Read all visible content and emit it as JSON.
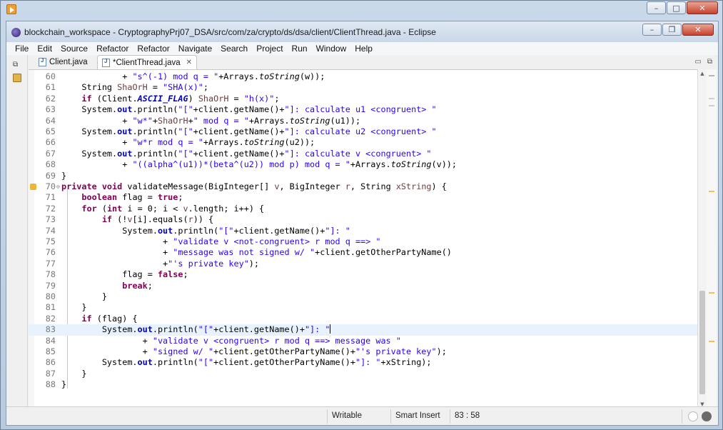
{
  "app": {
    "window_title": "blockchain_workspace - CryptographyPrj07_DSA/src/com/za/crypto/ds/dsa/client/ClientThread.java - Eclipse"
  },
  "menu": [
    "File",
    "Edit",
    "Source",
    "Refactor",
    "Refactor",
    "Navigate",
    "Search",
    "Project",
    "Run",
    "Window",
    "Help"
  ],
  "tabs": [
    {
      "label": "Client.java",
      "active": false
    },
    {
      "label": "*ClientThread.java",
      "active": true
    }
  ],
  "editor": {
    "current_line": 83,
    "lines": [
      {
        "n": "60",
        "parts": [
          [
            "t",
            "            + "
          ],
          [
            "s",
            "\"s^(-1) mod q = \""
          ],
          [
            "t",
            "+Arrays."
          ],
          [
            "i",
            "toString"
          ],
          [
            "t",
            "(w));"
          ]
        ]
      },
      {
        "n": "61",
        "parts": [
          [
            "t",
            "    String "
          ],
          [
            "v",
            "ShaOrH"
          ],
          [
            "t",
            " = "
          ],
          [
            "s",
            "\"SHA(x)\""
          ],
          [
            "t",
            ";"
          ]
        ]
      },
      {
        "n": "62",
        "parts": [
          [
            "t",
            "    "
          ],
          [
            "k",
            "if"
          ],
          [
            "t",
            " (Client."
          ],
          [
            "fi",
            "ASCII_FLAG"
          ],
          [
            "t",
            ") "
          ],
          [
            "v",
            "ShaOrH"
          ],
          [
            "t",
            " = "
          ],
          [
            "s",
            "\"h(x)\""
          ],
          [
            "t",
            ";"
          ]
        ]
      },
      {
        "n": "63",
        "parts": [
          [
            "t",
            "    System."
          ],
          [
            "f",
            "out"
          ],
          [
            "t",
            ".println("
          ],
          [
            "s",
            "\"[\""
          ],
          [
            "t",
            "+client.getName()+"
          ],
          [
            "s",
            "\"]: calculate u1 <congruent> \""
          ]
        ]
      },
      {
        "n": "64",
        "parts": [
          [
            "t",
            "            + "
          ],
          [
            "s",
            "\"w*\""
          ],
          [
            "t",
            "+"
          ],
          [
            "v",
            "ShaOrH"
          ],
          [
            "t",
            "+"
          ],
          [
            "s",
            "\" mod q = \""
          ],
          [
            "t",
            "+Arrays."
          ],
          [
            "i",
            "toString"
          ],
          [
            "t",
            "(u1));"
          ]
        ]
      },
      {
        "n": "65",
        "parts": [
          [
            "t",
            "    System."
          ],
          [
            "f",
            "out"
          ],
          [
            "t",
            ".println("
          ],
          [
            "s",
            "\"[\""
          ],
          [
            "t",
            "+client.getName()+"
          ],
          [
            "s",
            "\"]: calculate u2 <congruent> \""
          ]
        ]
      },
      {
        "n": "66",
        "parts": [
          [
            "t",
            "            + "
          ],
          [
            "s",
            "\"w*r mod q = \""
          ],
          [
            "t",
            "+Arrays."
          ],
          [
            "i",
            "toString"
          ],
          [
            "t",
            "(u2));"
          ]
        ]
      },
      {
        "n": "67",
        "parts": [
          [
            "t",
            "    System."
          ],
          [
            "f",
            "out"
          ],
          [
            "t",
            ".println("
          ],
          [
            "s",
            "\"[\""
          ],
          [
            "t",
            "+client.getName()+"
          ],
          [
            "s",
            "\"]: calculate v <congruent> \""
          ]
        ]
      },
      {
        "n": "68",
        "parts": [
          [
            "t",
            "            + "
          ],
          [
            "s",
            "\"((alpha^(u1))*(beta^(u2)) mod p) mod q = \""
          ],
          [
            "t",
            "+Arrays."
          ],
          [
            "i",
            "toString"
          ],
          [
            "t",
            "(v));"
          ]
        ]
      },
      {
        "n": "69",
        "parts": [
          [
            "t",
            "}"
          ]
        ]
      },
      {
        "n": "70",
        "parts": [
          [
            "k",
            "private"
          ],
          [
            "t",
            " "
          ],
          [
            "k",
            "void"
          ],
          [
            "t",
            " validateMessage(BigInteger[] "
          ],
          [
            "v",
            "v"
          ],
          [
            "t",
            ", BigInteger "
          ],
          [
            "v",
            "r"
          ],
          [
            "t",
            ", String "
          ],
          [
            "v",
            "xString"
          ],
          [
            "t",
            ") {"
          ]
        ]
      },
      {
        "n": "71",
        "parts": [
          [
            "t",
            "    "
          ],
          [
            "k",
            "boolean"
          ],
          [
            "t",
            " flag = "
          ],
          [
            "k",
            "true"
          ],
          [
            "t",
            ";"
          ]
        ]
      },
      {
        "n": "72",
        "parts": [
          [
            "t",
            "    "
          ],
          [
            "k",
            "for"
          ],
          [
            "t",
            " ("
          ],
          [
            "k",
            "int"
          ],
          [
            "t",
            " i = 0; i < "
          ],
          [
            "v",
            "v"
          ],
          [
            "t",
            ".length; i++) {"
          ]
        ]
      },
      {
        "n": "73",
        "parts": [
          [
            "t",
            "        "
          ],
          [
            "k",
            "if"
          ],
          [
            "t",
            " (!"
          ],
          [
            "v",
            "v"
          ],
          [
            "t",
            "[i].equals("
          ],
          [
            "v",
            "r"
          ],
          [
            "t",
            ")) {"
          ]
        ]
      },
      {
        "n": "74",
        "parts": [
          [
            "t",
            "            System."
          ],
          [
            "f",
            "out"
          ],
          [
            "t",
            ".println("
          ],
          [
            "s",
            "\"[\""
          ],
          [
            "t",
            "+client.getName()+"
          ],
          [
            "s",
            "\"]: \""
          ]
        ]
      },
      {
        "n": "75",
        "parts": [
          [
            "t",
            "                    + "
          ],
          [
            "s",
            "\"validate v <not-congruent> r mod q ==> \""
          ]
        ]
      },
      {
        "n": "76",
        "parts": [
          [
            "t",
            "                    + "
          ],
          [
            "s",
            "\"message was not signed w/ \""
          ],
          [
            "t",
            "+client.getOtherPartyName()"
          ]
        ]
      },
      {
        "n": "77",
        "parts": [
          [
            "t",
            "                    +"
          ],
          [
            "s",
            "\"'s private key\""
          ],
          [
            "t",
            ");"
          ]
        ]
      },
      {
        "n": "78",
        "parts": [
          [
            "t",
            "            flag = "
          ],
          [
            "k",
            "false"
          ],
          [
            "t",
            ";"
          ]
        ]
      },
      {
        "n": "79",
        "parts": [
          [
            "t",
            "            "
          ],
          [
            "k",
            "break"
          ],
          [
            "t",
            ";"
          ]
        ]
      },
      {
        "n": "80",
        "parts": [
          [
            "t",
            "        }"
          ]
        ]
      },
      {
        "n": "81",
        "parts": [
          [
            "t",
            "    }"
          ]
        ]
      },
      {
        "n": "82",
        "parts": [
          [
            "t",
            "    "
          ],
          [
            "k",
            "if"
          ],
          [
            "t",
            " (flag) {"
          ]
        ]
      },
      {
        "n": "83",
        "parts": [
          [
            "t",
            "        System."
          ],
          [
            "f",
            "out"
          ],
          [
            "t",
            ".println("
          ],
          [
            "s",
            "\"[\""
          ],
          [
            "t",
            "+client.getName()+"
          ],
          [
            "s",
            "\"]: \""
          ],
          [
            "c",
            ""
          ]
        ]
      },
      {
        "n": "84",
        "parts": [
          [
            "t",
            "                + "
          ],
          [
            "s",
            "\"validate v <congruent> r mod q ==> message was \""
          ]
        ]
      },
      {
        "n": "85",
        "parts": [
          [
            "t",
            "                + "
          ],
          [
            "s",
            "\"signed w/ \""
          ],
          [
            "t",
            "+client.getOtherPartyName()+"
          ],
          [
            "s",
            "\"'s private key\""
          ],
          [
            "t",
            ");"
          ]
        ]
      },
      {
        "n": "86",
        "parts": [
          [
            "t",
            "        System."
          ],
          [
            "f",
            "out"
          ],
          [
            "t",
            ".println("
          ],
          [
            "s",
            "\"[\""
          ],
          [
            "t",
            "+client.getOtherPartyName()+"
          ],
          [
            "s",
            "\"]: \""
          ],
          [
            "t",
            "+xString);"
          ]
        ]
      },
      {
        "n": "87",
        "parts": [
          [
            "t",
            "    }"
          ]
        ]
      },
      {
        "n": "88",
        "parts": [
          [
            "t",
            "}"
          ]
        ]
      }
    ]
  },
  "status": {
    "mode": "Writable",
    "insert": "Smart Insert",
    "position": "83 : 58"
  },
  "icons": {
    "app": "recorder-icon",
    "eclipse": "eclipse-icon",
    "restore": "restore-icon",
    "close": "close-icon"
  }
}
